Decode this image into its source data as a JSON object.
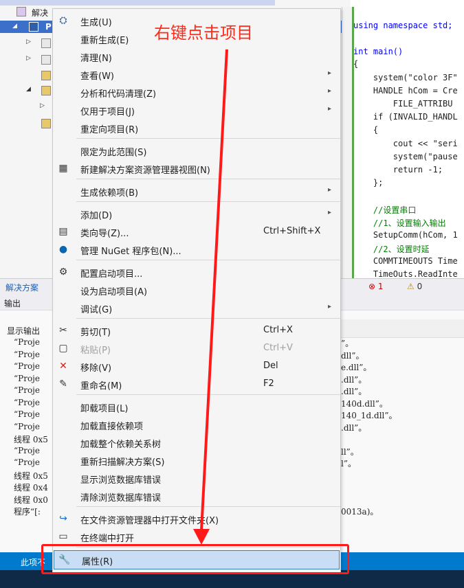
{
  "solution": {
    "root_label": "解决",
    "project_label": "P",
    "footer_label": "解决方案",
    "error_count": "1",
    "warning_count": "0"
  },
  "editor": {
    "lines": [
      "using namespace std;",
      "",
      "int main()",
      "{",
      "    system(\"color 3F\"",
      "    HANDLE hCom = Cre",
      "        FILE_ATTRIBU",
      "    if (INVALID_HANDL",
      "    {",
      "        cout << \"seri",
      "        system(\"pause",
      "        return -1;",
      "    };",
      "",
      "    //设置串口",
      "    //1、设置输入输出",
      "    SetupComm(hCom, 1",
      "    //2、设置时延",
      "    COMMTIMEOUTS Time",
      "    TimeOuts.ReadInte"
    ]
  },
  "output": {
    "title": "输出",
    "show_from": "显示输出",
    "lines": [
      "“Proje",
      "“Proje",
      "“Proje",
      "“Proje",
      "“Proje",
      "“Proje",
      "“Proje",
      "“Proje",
      "线程 0x5",
      "“Proje",
      "“Proje",
      "线程 0x5",
      "线程 0x4",
      "线程 0x0",
      "程序“[:"
    ],
    "right_fragments": [
      "”。",
      "dll”。",
      "e.dll”。",
      ".dll”。",
      ".dll”。",
      "140d.dll”。",
      "140_1d.dll”。",
      ".dll”。",
      "",
      "ll”。",
      "l”。",
      "",
      "",
      "",
      "0013a)。"
    ]
  },
  "status": {
    "text": "此项不"
  },
  "menu": {
    "items": [
      {
        "label": "生成(U)",
        "icon": "build-icon",
        "shortcut": "",
        "arrow": false,
        "disabled": false
      },
      {
        "label": "重新生成(E)",
        "icon": "",
        "shortcut": "",
        "arrow": false,
        "disabled": false
      },
      {
        "label": "清理(N)",
        "icon": "",
        "shortcut": "",
        "arrow": false,
        "disabled": false
      },
      {
        "label": "查看(W)",
        "icon": "",
        "shortcut": "",
        "arrow": true,
        "disabled": false
      },
      {
        "label": "分析和代码清理(Z)",
        "icon": "",
        "shortcut": "",
        "arrow": true,
        "disabled": false
      },
      {
        "label": "仅用于项目(J)",
        "icon": "",
        "shortcut": "",
        "arrow": true,
        "disabled": false
      },
      {
        "label": "重定向项目(R)",
        "icon": "",
        "shortcut": "",
        "arrow": false,
        "disabled": false
      },
      {
        "label": "限定为此范围(S)",
        "icon": "",
        "shortcut": "",
        "arrow": false,
        "disabled": false
      },
      {
        "label": "新建解决方案资源管理器视图(N)",
        "icon": "new-view-icon",
        "shortcut": "",
        "arrow": false,
        "disabled": false
      },
      {
        "label": "生成依赖项(B)",
        "icon": "",
        "shortcut": "",
        "arrow": true,
        "disabled": false
      },
      {
        "label": "添加(D)",
        "icon": "",
        "shortcut": "",
        "arrow": true,
        "disabled": false
      },
      {
        "label": "类向导(Z)...",
        "icon": "class-wizard-icon",
        "shortcut": "Ctrl+Shift+X",
        "arrow": false,
        "disabled": false
      },
      {
        "label": "管理 NuGet 程序包(N)...",
        "icon": "nuget-icon",
        "shortcut": "",
        "arrow": false,
        "disabled": false
      },
      {
        "label": "配置启动项目...",
        "icon": "gear-icon",
        "shortcut": "",
        "arrow": false,
        "disabled": false
      },
      {
        "label": "设为启动项目(A)",
        "icon": "",
        "shortcut": "",
        "arrow": false,
        "disabled": false
      },
      {
        "label": "调试(G)",
        "icon": "",
        "shortcut": "",
        "arrow": true,
        "disabled": false
      },
      {
        "label": "剪切(T)",
        "icon": "cut-icon",
        "shortcut": "Ctrl+X",
        "arrow": false,
        "disabled": false
      },
      {
        "label": "粘贴(P)",
        "icon": "paste-icon",
        "shortcut": "Ctrl+V",
        "arrow": false,
        "disabled": true
      },
      {
        "label": "移除(V)",
        "icon": "remove-icon",
        "shortcut": "Del",
        "arrow": false,
        "disabled": false
      },
      {
        "label": "重命名(M)",
        "icon": "rename-icon",
        "shortcut": "F2",
        "arrow": false,
        "disabled": false
      },
      {
        "label": "卸载项目(L)",
        "icon": "",
        "shortcut": "",
        "arrow": false,
        "disabled": false
      },
      {
        "label": "加载直接依赖项",
        "icon": "",
        "shortcut": "",
        "arrow": false,
        "disabled": false
      },
      {
        "label": "加载整个依赖关系树",
        "icon": "",
        "shortcut": "",
        "arrow": false,
        "disabled": false
      },
      {
        "label": "重新扫描解决方案(S)",
        "icon": "",
        "shortcut": "",
        "arrow": false,
        "disabled": false
      },
      {
        "label": "显示浏览数据库错误",
        "icon": "",
        "shortcut": "",
        "arrow": false,
        "disabled": false
      },
      {
        "label": "清除浏览数据库错误",
        "icon": "",
        "shortcut": "",
        "arrow": false,
        "disabled": false
      },
      {
        "label": "在文件资源管理器中打开文件夹(X)",
        "icon": "open-folder-icon",
        "shortcut": "",
        "arrow": false,
        "disabled": false
      },
      {
        "label": "在终端中打开",
        "icon": "terminal-icon",
        "shortcut": "",
        "arrow": false,
        "disabled": false
      },
      {
        "label": "属性(R)",
        "icon": "wrench-icon",
        "shortcut": "",
        "arrow": false,
        "disabled": false,
        "highlighted": true
      }
    ]
  },
  "annotation": {
    "text": "右键点击项目",
    "color": "#ff2a1a"
  }
}
